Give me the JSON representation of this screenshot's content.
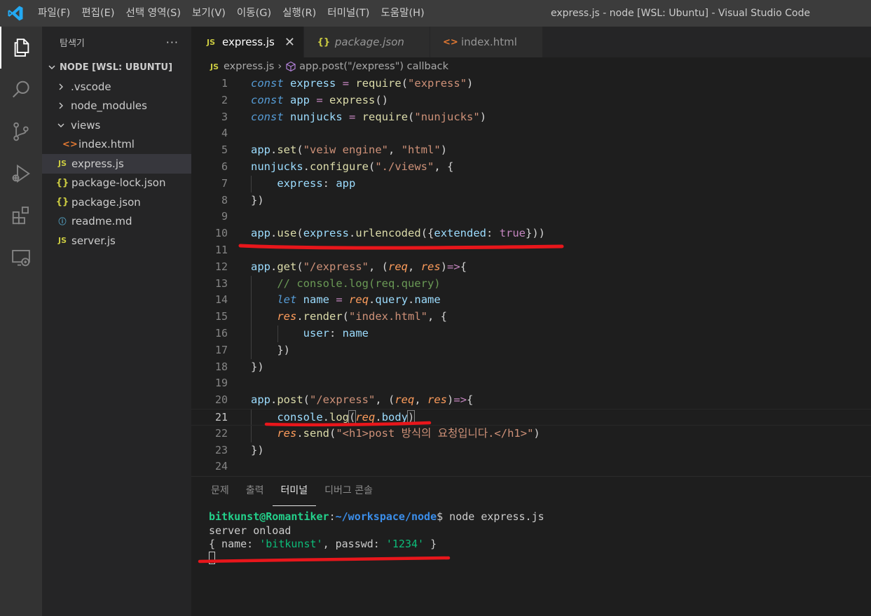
{
  "window": {
    "title": "express.js - node [WSL: Ubuntu] - Visual Studio Code",
    "menu": [
      "파일(F)",
      "편집(E)",
      "선택 영역(S)",
      "보기(V)",
      "이동(G)",
      "실행(R)",
      "터미널(T)",
      "도움말(H)"
    ]
  },
  "activity_bar": {
    "items": [
      "files-icon",
      "search-icon",
      "source-control-icon",
      "run-debug-icon",
      "extensions-icon",
      "remote-explorer-icon"
    ]
  },
  "sidebar": {
    "title": "탐색기",
    "more": "···",
    "section": "NODE [WSL: UBUNTU]",
    "items": [
      {
        "label": ".vscode",
        "type": "folder",
        "expanded": false
      },
      {
        "label": "node_modules",
        "type": "folder",
        "expanded": false
      },
      {
        "label": "views",
        "type": "folder",
        "expanded": true
      },
      {
        "label": "index.html",
        "type": "html"
      },
      {
        "label": "express.js",
        "type": "js",
        "selected": true
      },
      {
        "label": "package-lock.json",
        "type": "json"
      },
      {
        "label": "package.json",
        "type": "json"
      },
      {
        "label": "readme.md",
        "type": "info"
      },
      {
        "label": "server.js",
        "type": "js"
      }
    ]
  },
  "tabs": [
    {
      "label": "express.js",
      "icon": "JS",
      "active": true,
      "close": "✕"
    },
    {
      "label": "package.json",
      "icon": "{}",
      "active": false
    },
    {
      "label": "index.html",
      "icon": "<>",
      "active": false
    }
  ],
  "breadcrumb": {
    "file_icon": "JS",
    "file": "express.js",
    "separator": "›",
    "symbol": "app.post(\"/express\") callback"
  },
  "editor": {
    "current_line": 21,
    "lines": [
      {
        "n": "1",
        "tokens": [
          [
            "kw",
            "const"
          ],
          [
            "txt",
            " "
          ],
          [
            "var",
            "express"
          ],
          [
            "txt",
            " "
          ],
          [
            "op",
            "="
          ],
          [
            "txt",
            " "
          ],
          [
            "fn",
            "require"
          ],
          [
            "txt",
            "("
          ],
          [
            "str",
            "\"express\""
          ],
          [
            "txt",
            ")"
          ]
        ]
      },
      {
        "n": "2",
        "tokens": [
          [
            "kw",
            "const"
          ],
          [
            "txt",
            " "
          ],
          [
            "var",
            "app"
          ],
          [
            "txt",
            " "
          ],
          [
            "op",
            "="
          ],
          [
            "txt",
            " "
          ],
          [
            "fn",
            "express"
          ],
          [
            "txt",
            "()"
          ]
        ]
      },
      {
        "n": "3",
        "tokens": [
          [
            "kw",
            "const"
          ],
          [
            "txt",
            " "
          ],
          [
            "var",
            "nunjucks"
          ],
          [
            "txt",
            " "
          ],
          [
            "op",
            "="
          ],
          [
            "txt",
            " "
          ],
          [
            "fn",
            "require"
          ],
          [
            "txt",
            "("
          ],
          [
            "str",
            "\"nunjucks\""
          ],
          [
            "txt",
            ")"
          ]
        ]
      },
      {
        "n": "4",
        "tokens": []
      },
      {
        "n": "5",
        "tokens": [
          [
            "var",
            "app"
          ],
          [
            "txt",
            "."
          ],
          [
            "fn",
            "set"
          ],
          [
            "txt",
            "("
          ],
          [
            "str",
            "\"veiw engine\""
          ],
          [
            "txt",
            ", "
          ],
          [
            "str",
            "\"html\""
          ],
          [
            "txt",
            ")"
          ]
        ]
      },
      {
        "n": "6",
        "tokens": [
          [
            "var",
            "nunjucks"
          ],
          [
            "txt",
            "."
          ],
          [
            "fn",
            "configure"
          ],
          [
            "txt",
            "("
          ],
          [
            "str",
            "\"./views\""
          ],
          [
            "txt",
            ", {"
          ]
        ]
      },
      {
        "n": "7",
        "tokens": [
          [
            "txt",
            "    "
          ],
          [
            "var",
            "express"
          ],
          [
            "txt",
            ": "
          ],
          [
            "var",
            "app"
          ]
        ]
      },
      {
        "n": "8",
        "tokens": [
          [
            "txt",
            "})"
          ]
        ]
      },
      {
        "n": "9",
        "tokens": []
      },
      {
        "n": "10",
        "tokens": [
          [
            "var",
            "app"
          ],
          [
            "txt",
            "."
          ],
          [
            "fn",
            "use"
          ],
          [
            "txt",
            "("
          ],
          [
            "var",
            "express"
          ],
          [
            "txt",
            "."
          ],
          [
            "fn",
            "urlencoded"
          ],
          [
            "txt",
            "({"
          ],
          [
            "var",
            "extended"
          ],
          [
            "txt",
            ": "
          ],
          [
            "bool",
            "true"
          ],
          [
            "txt",
            "}))"
          ]
        ]
      },
      {
        "n": "11",
        "tokens": []
      },
      {
        "n": "12",
        "tokens": [
          [
            "var",
            "app"
          ],
          [
            "txt",
            "."
          ],
          [
            "fn",
            "get"
          ],
          [
            "txt",
            "("
          ],
          [
            "str",
            "\"/express\""
          ],
          [
            "txt",
            ", ("
          ],
          [
            "prm",
            "req"
          ],
          [
            "txt",
            ", "
          ],
          [
            "prm",
            "res"
          ],
          [
            "txt",
            ")"
          ],
          [
            "op",
            "=>"
          ],
          [
            "txt",
            "{"
          ]
        ]
      },
      {
        "n": "13",
        "tokens": [
          [
            "txt",
            "    "
          ],
          [
            "cmt",
            "// console.log(req.query)"
          ]
        ]
      },
      {
        "n": "14",
        "tokens": [
          [
            "txt",
            "    "
          ],
          [
            "kw",
            "let"
          ],
          [
            "txt",
            " "
          ],
          [
            "var",
            "name"
          ],
          [
            "txt",
            " "
          ],
          [
            "op",
            "="
          ],
          [
            "txt",
            " "
          ],
          [
            "prm",
            "req"
          ],
          [
            "txt",
            "."
          ],
          [
            "var",
            "query"
          ],
          [
            "txt",
            "."
          ],
          [
            "var",
            "name"
          ]
        ]
      },
      {
        "n": "15",
        "tokens": [
          [
            "txt",
            "    "
          ],
          [
            "prm",
            "res"
          ],
          [
            "txt",
            "."
          ],
          [
            "fn",
            "render"
          ],
          [
            "txt",
            "("
          ],
          [
            "str",
            "\"index.html\""
          ],
          [
            "txt",
            ", {"
          ]
        ]
      },
      {
        "n": "16",
        "tokens": [
          [
            "txt",
            "        "
          ],
          [
            "var",
            "user"
          ],
          [
            "txt",
            ": "
          ],
          [
            "var",
            "name"
          ]
        ]
      },
      {
        "n": "17",
        "tokens": [
          [
            "txt",
            "    })"
          ]
        ]
      },
      {
        "n": "18",
        "tokens": [
          [
            "txt",
            "})"
          ]
        ]
      },
      {
        "n": "19",
        "tokens": []
      },
      {
        "n": "20",
        "tokens": [
          [
            "var",
            "app"
          ],
          [
            "txt",
            "."
          ],
          [
            "fn",
            "post"
          ],
          [
            "txt",
            "("
          ],
          [
            "str",
            "\"/express\""
          ],
          [
            "txt",
            ", ("
          ],
          [
            "prm",
            "req"
          ],
          [
            "txt",
            ", "
          ],
          [
            "prm",
            "res"
          ],
          [
            "txt",
            ")"
          ],
          [
            "op",
            "=>"
          ],
          [
            "txt",
            "{"
          ]
        ]
      },
      {
        "n": "21",
        "tokens": [
          [
            "txt",
            "    "
          ],
          [
            "var",
            "console"
          ],
          [
            "txt",
            "."
          ],
          [
            "fn",
            "log"
          ],
          [
            "bm",
            "("
          ],
          [
            "prm",
            "req"
          ],
          [
            "txt",
            "."
          ],
          [
            "var",
            "body"
          ],
          [
            "bm",
            ")"
          ]
        ]
      },
      {
        "n": "22",
        "tokens": [
          [
            "txt",
            "    "
          ],
          [
            "prm",
            "res"
          ],
          [
            "txt",
            "."
          ],
          [
            "fn",
            "send"
          ],
          [
            "txt",
            "("
          ],
          [
            "str",
            "\"<h1>post 방식의 요청입니다.</h1>\""
          ],
          [
            "txt",
            ")"
          ]
        ]
      },
      {
        "n": "23",
        "tokens": [
          [
            "txt",
            "})"
          ]
        ]
      },
      {
        "n": "24",
        "tokens": []
      }
    ]
  },
  "panel": {
    "tabs": [
      "문제",
      "출력",
      "터미널",
      "디버그 콘솔"
    ],
    "active_tab": 2,
    "terminal": {
      "prompt_user": "bitkunst@Romantiker",
      "prompt_sep": ":",
      "prompt_path": "~/workspace/node",
      "prompt_end": "$",
      "command": " node express.js",
      "line2": "server onload",
      "line3_pre": "{ name: ",
      "line3_name": "'bitkunst'",
      "line3_mid": ", passwd: ",
      "line3_pass": "'1234'",
      "line3_post": " }"
    }
  },
  "colors": {
    "annotation": "#e8161b",
    "accent": "#007acc"
  }
}
